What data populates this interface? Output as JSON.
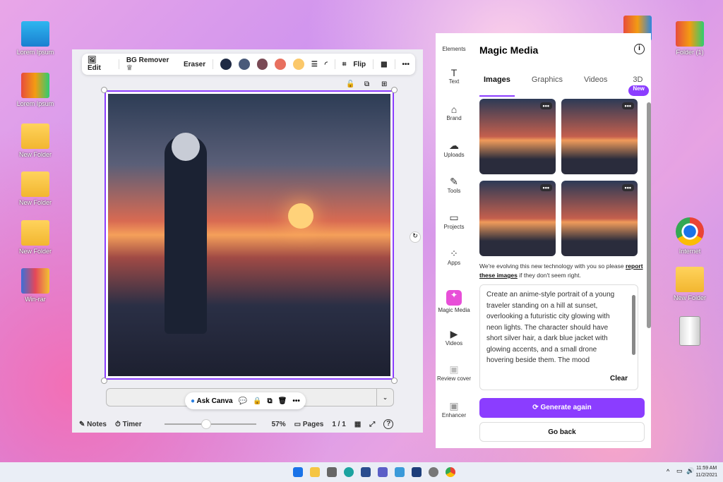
{
  "desktop": {
    "icons": [
      {
        "label": "Lorem Ipsum"
      },
      {
        "label": "Lorem Ipsum"
      },
      {
        "label": "New Folder"
      },
      {
        "label": "New Folder"
      },
      {
        "label": "New Folder"
      },
      {
        "label": "Win-rar"
      },
      {
        "label": "Folder (1)"
      },
      {
        "label": "Internet"
      },
      {
        "label": "New Folder"
      }
    ]
  },
  "toolbar": {
    "edit": "Edit",
    "bg_remover": "BG Remover",
    "eraser": "Eraser",
    "flip": "Flip",
    "more": "•••",
    "colors": [
      "#1f2a44",
      "#4a5a7a",
      "#7a4a55",
      "#e8705f",
      "#fbc86a"
    ]
  },
  "canvas_bar": {
    "ask": "Ask Canva",
    "more": "•••"
  },
  "footer": {
    "notes": "Notes",
    "timer": "Timer",
    "zoom": "57%",
    "zoom_level": 57,
    "pages": "Pages",
    "page_count": "1 / 1"
  },
  "rail": [
    {
      "label": "Elements"
    },
    {
      "label": "Text"
    },
    {
      "label": "Brand"
    },
    {
      "label": "Uploads"
    },
    {
      "label": "Tools"
    },
    {
      "label": "Projects"
    },
    {
      "label": "Apps"
    },
    {
      "label": "Magic Media"
    },
    {
      "label": "Videos"
    },
    {
      "label": "Review cover"
    },
    {
      "label": "Enhancer"
    }
  ],
  "panel": {
    "title": "Magic Media",
    "tabs": [
      "Images",
      "Graphics",
      "Videos",
      "3D"
    ],
    "new_badge": "New",
    "thumb_more": "•••",
    "note_pre": "We're evolving this new technology with you so please ",
    "note_link": "report these images",
    "note_post": " if they don't seem right.",
    "prompt": "Create an anime-style portrait of a young traveler standing on a hill at sunset, overlooking a futuristic city glowing with neon lights. The character should have short silver hair, a dark blue jacket with glowing accents, and a small drone hovering beside them. The mood",
    "clear": "Clear",
    "generate": "Generate again",
    "back": "Go back"
  },
  "taskbar": {
    "time": "11:59 AM",
    "date": "11/2/2021"
  },
  "accent": "#8b3dff"
}
